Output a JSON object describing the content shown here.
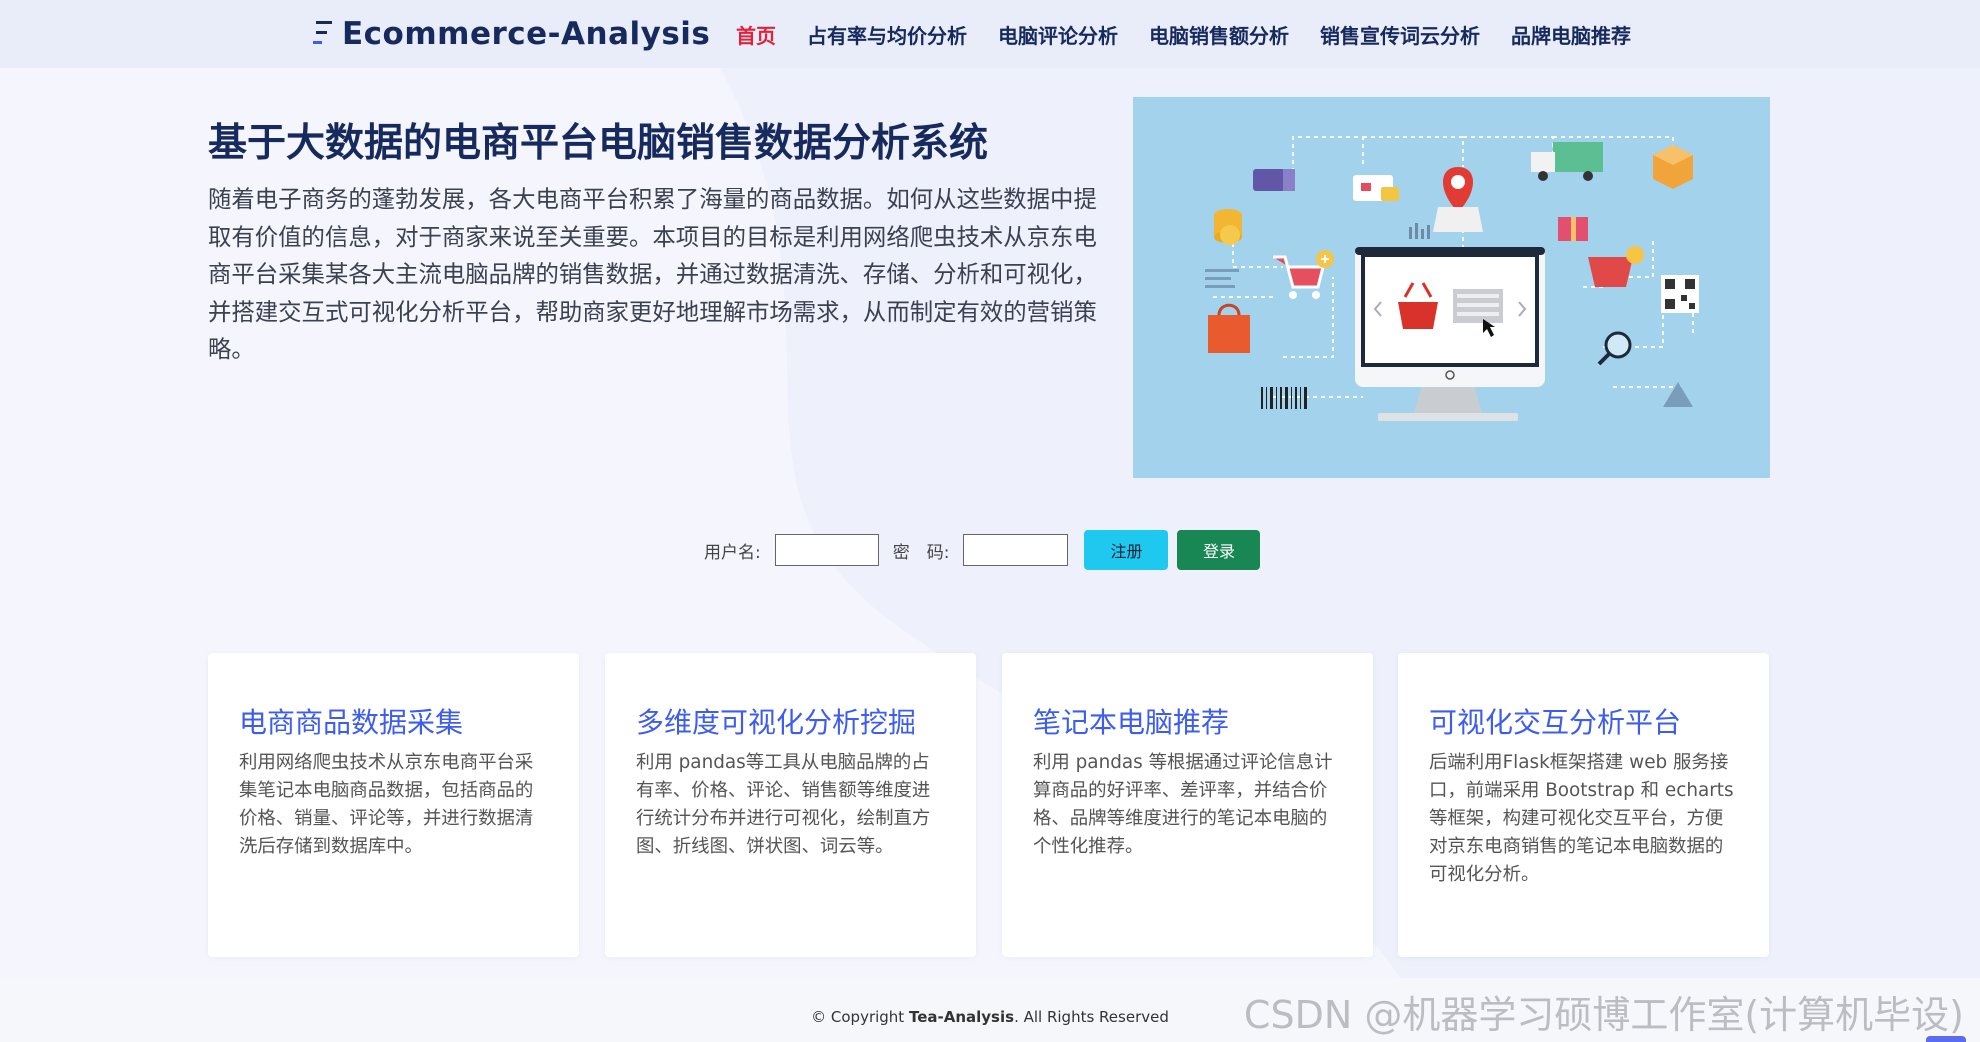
{
  "header": {
    "brand": "Ecommerce-Analysis",
    "nav": [
      {
        "label": "首页",
        "active": true
      },
      {
        "label": "占有率与均价分析"
      },
      {
        "label": "电脑评论分析"
      },
      {
        "label": "电脑销售额分析"
      },
      {
        "label": "销售宣传词云分析"
      },
      {
        "label": "品牌电脑推荐"
      }
    ]
  },
  "hero": {
    "title": "基于大数据的电商平台电脑销售数据分析系统",
    "description": "随着电子商务的蓬勃发展，各大电商平台积累了海量的商品数据。如何从这些数据中提取有价值的信息，对于商家来说至关重要。本项目的目标是利用网络爬虫技术从京东电商平台采集某各大主流电脑品牌的销售数据，并通过数据清洗、存储、分析和可视化，并搭建交互式可视化分析平台，帮助商家更好地理解市场需求，从而制定有效的营销策略。"
  },
  "login": {
    "username_label": "用户名:",
    "password_label": "密　码:",
    "username_value": "",
    "password_value": "",
    "register_label": "注册",
    "login_label": "登录"
  },
  "cards": [
    {
      "title": "电商商品数据采集",
      "text": "利用网络爬虫技术从京东电商平台采集笔记本电脑商品数据，包括商品的价格、销量、评论等，并进行数据清洗后存储到数据库中。"
    },
    {
      "title": "多维度可视化分析挖掘",
      "text": "利用 pandas等工具从电脑品牌的占有率、价格、评论、销售额等维度进行统计分布并进行可视化，绘制直方图、折线图、饼状图、词云等。"
    },
    {
      "title": "笔记本电脑推荐",
      "text": "利用 pandas 等根据通过评论信息计算商品的好评率、差评率，并结合价格、品牌等维度进行的笔记本电脑的个性化推荐。"
    },
    {
      "title": "可视化交互分析平台",
      "text": "后端利用Flask框架搭建 web 服务接口，前端采用 Bootstrap 和 echarts 等框架，构建可视化交互平台，方便对京东电商销售的笔记本电脑数据的可视化分析。"
    }
  ],
  "footer": {
    "prefix": "© Copyright ",
    "brand": "Tea-Analysis",
    "suffix": ". All Rights Reserved"
  },
  "watermark": "CSDN @机器学习硕博工作室(计算机毕设)",
  "colors": {
    "nav_text": "#172a5e",
    "nav_active": "#e0233a",
    "card_title": "#3d5cf0",
    "register_button": "#1fc8ee",
    "login_button": "#198754"
  }
}
